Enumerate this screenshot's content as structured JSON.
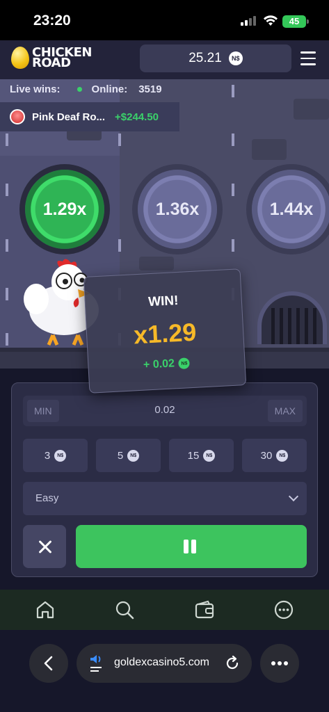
{
  "status": {
    "time": "23:20",
    "battery": "45"
  },
  "header": {
    "logo_line1": "CHICKEN",
    "logo_line2": "ROAD",
    "balance": "25.21",
    "currency_badge": "N$"
  },
  "live": {
    "live_wins_label": "Live wins:",
    "online_label": "Online:",
    "online_value": "3519",
    "winner_name": "Pink Deaf Ro...",
    "winner_amount": "+$244.50"
  },
  "multipliers": [
    "1.29x",
    "1.36x",
    "1.44x"
  ],
  "popup": {
    "title": "WIN!",
    "multiplier": "x1.29",
    "gain": "+ 0.02",
    "badge": "N$"
  },
  "controls": {
    "min_label": "MIN",
    "max_label": "MAX",
    "bet_value": "0.02",
    "chips": [
      "3",
      "5",
      "15",
      "30"
    ],
    "chip_badge": "N$",
    "difficulty": "Easy"
  },
  "bottom_nav": [
    "home-icon",
    "search-icon",
    "wallet-icon",
    "more-icon"
  ],
  "browser": {
    "url": "goldexcasino5.com"
  },
  "colors": {
    "green": "#3dc45e",
    "gold": "#f7b928",
    "panel": "#2b2c45"
  }
}
